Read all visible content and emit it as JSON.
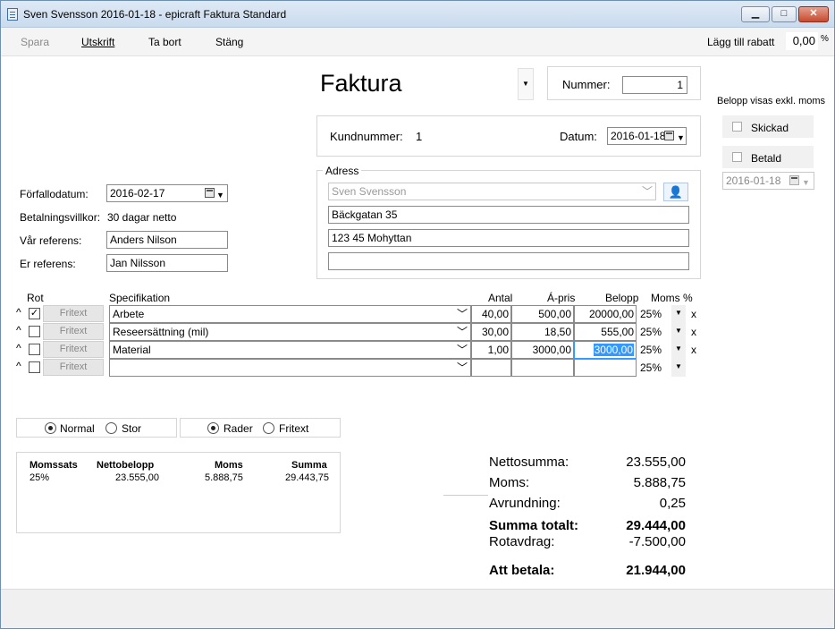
{
  "window": {
    "title": "Sven Svensson 2016-01-18 - epicraft Faktura Standard",
    "min": "▁",
    "max": "□",
    "close": "✕"
  },
  "toolbar": {
    "spara": "Spara",
    "utskrift": "Utskrift",
    "ta_bort": "Ta bort",
    "stang": "Stäng",
    "rabatt_label": "Lägg till rabatt",
    "rabatt_value": "0,00",
    "rabatt_unit": "%"
  },
  "doc": {
    "title": "Faktura",
    "nummer_label": "Nummer:",
    "nummer_value": "1",
    "kundnummer_label": "Kundnummer:",
    "kundnummer_value": "1",
    "datum_label": "Datum:",
    "datum_value": "2016-01-18"
  },
  "side": {
    "belopp_note": "Belopp visas exkl. moms",
    "skickad": "Skickad",
    "betald": "Betald",
    "betald_date": "2016-01-18"
  },
  "adress": {
    "legend": "Adress",
    "name": "Sven Svensson",
    "line1": "Bäckgatan 35",
    "line2": "123 45 Mohyttan",
    "line3": ""
  },
  "left": {
    "forfallodatum_label": "Förfallodatum:",
    "forfallodatum_value": "2016-02-17",
    "betalningsvillkor_label": "Betalningsvillkor:",
    "betalningsvillkor_value": "30 dagar netto",
    "var_referens_label": "Vår referens:",
    "var_referens_value": "Anders Nilson",
    "er_referens_label": "Er referens:",
    "er_referens_value": "Jan Nilsson"
  },
  "grid": {
    "headers": {
      "rot": "Rot",
      "spec": "Specifikation",
      "antal": "Antal",
      "apris": "Á-pris",
      "belopp": "Belopp",
      "moms": "Moms %"
    },
    "fritext_label": "Fritext",
    "caret": "^",
    "remove": "x",
    "rows": [
      {
        "rot": "✓",
        "spec": "Arbete",
        "antal": "40,00",
        "apris": "500,00",
        "belopp": "20000,00",
        "moms": "25%"
      },
      {
        "rot": "",
        "spec": "Reseersättning (mil)",
        "antal": "30,00",
        "apris": "18,50",
        "belopp": "555,00",
        "moms": "25%"
      },
      {
        "rot": "",
        "spec": "Material",
        "antal": "1,00",
        "apris": "3000,00",
        "belopp": "3000,00",
        "moms": "25%"
      },
      {
        "rot": "",
        "spec": "",
        "antal": "",
        "apris": "",
        "belopp": "",
        "moms": "25%"
      }
    ]
  },
  "options": {
    "normal": "Normal",
    "stor": "Stor",
    "rader": "Rader",
    "fritext": "Fritext"
  },
  "vat_table": {
    "headers": [
      "Momssats",
      "Nettobelopp",
      "Moms",
      "Summa"
    ],
    "row": [
      "25%",
      "23.555,00",
      "5.888,75",
      "29.443,75"
    ]
  },
  "summary": {
    "netto_label": "Nettosumma:",
    "netto_value": "23.555,00",
    "moms_label": "Moms:",
    "moms_value": "5.888,75",
    "avrundning_label": "Avrundning:",
    "avrundning_value": "0,25",
    "summa_label": "Summa totalt:",
    "summa_value": "29.444,00",
    "rot_label": "Rotavdrag:",
    "rot_value": "-7.500,00",
    "att_betala_label": "Att betala:",
    "att_betala_value": "21.944,00"
  }
}
